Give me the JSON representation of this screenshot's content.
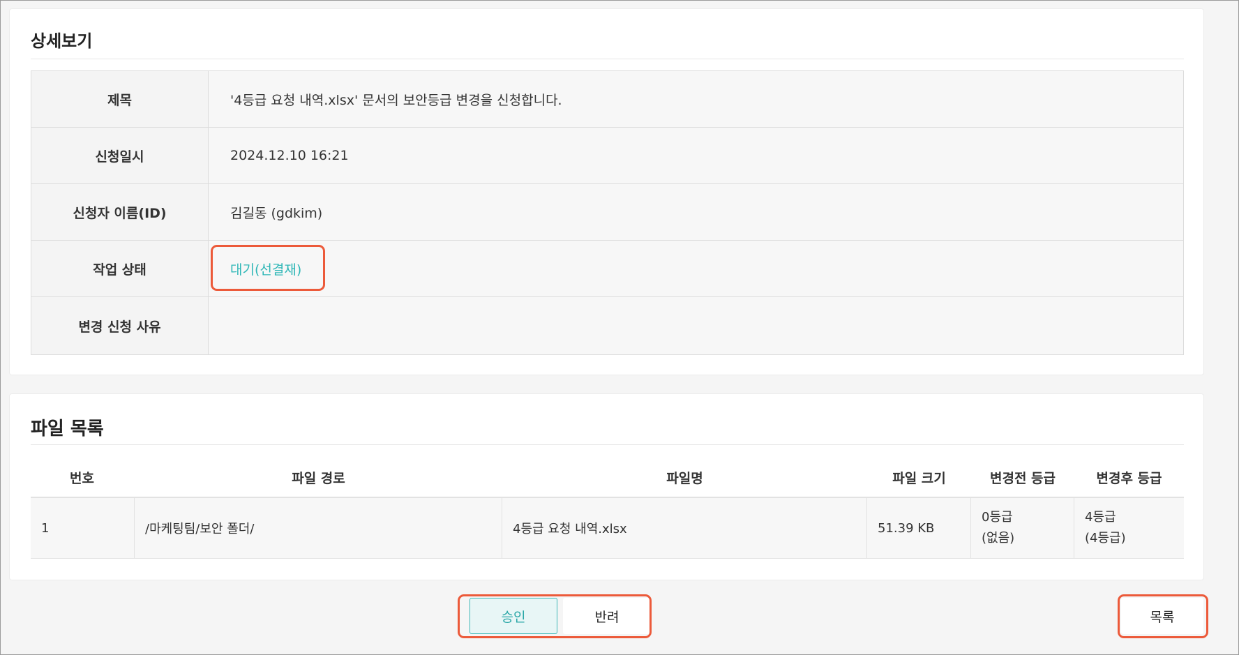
{
  "detail": {
    "title": "상세보기",
    "rows": [
      {
        "label": "제목",
        "value": "'4등급 요청 내역.xlsx' 문서의 보안등급 변경을 신청합니다."
      },
      {
        "label": "신청일시",
        "value": "2024.12.10 16:21"
      },
      {
        "label": "신청자 이름(ID)",
        "value": "김길동 (gdkim)"
      },
      {
        "label": "작업 상태",
        "value": "대기(선결재)"
      },
      {
        "label": "변경 신청 사유",
        "value": ""
      }
    ]
  },
  "files": {
    "title": "파일 목록",
    "headers": [
      "번호",
      "파일 경로",
      "파일명",
      "파일 크기",
      "변경전 등급",
      "변경후 등급"
    ],
    "rows": [
      {
        "no": "1",
        "path": "/마케팅팀/보안 폴더/",
        "name": "4등급 요청 내역.xlsx",
        "size": "51.39 KB",
        "before_grade": "0등급",
        "before_grade_note": "(없음)",
        "after_grade": "4등급",
        "after_grade_note": "(4등급)"
      }
    ]
  },
  "actions": {
    "approve_label": "승인",
    "reject_label": "반려",
    "list_label": "목록"
  },
  "colors": {
    "accent": "#2fb7b7",
    "highlight": "#ec5a3a"
  }
}
